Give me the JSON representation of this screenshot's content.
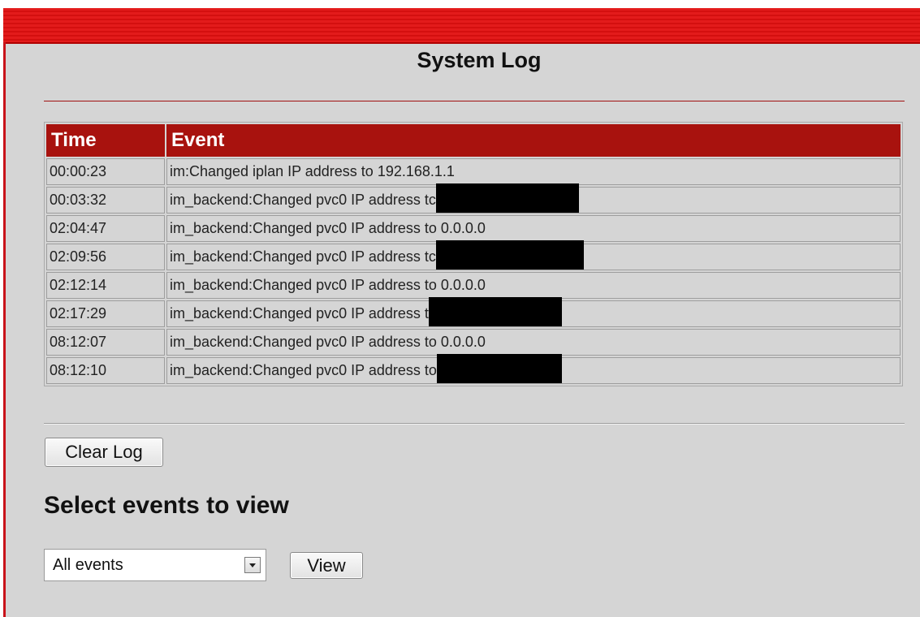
{
  "page": {
    "title": "System Log"
  },
  "log_table": {
    "headers": {
      "time": "Time",
      "event": "Event"
    },
    "rows": [
      {
        "time": "00:00:23",
        "event": "im:Changed iplan IP address to 192.168.1.1",
        "redacted": false
      },
      {
        "time": "00:03:32",
        "event": "im_backend:Changed pvc0 IP address tc",
        "redacted": true
      },
      {
        "time": "02:04:47",
        "event": "im_backend:Changed pvc0 IP address to 0.0.0.0",
        "redacted": false
      },
      {
        "time": "02:09:56",
        "event": "im_backend:Changed pvc0 IP address tc",
        "redacted": true
      },
      {
        "time": "02:12:14",
        "event": "im_backend:Changed pvc0 IP address to 0.0.0.0",
        "redacted": false
      },
      {
        "time": "02:17:29",
        "event": "im_backend:Changed pvc0 IP address t",
        "redacted": true
      },
      {
        "time": "08:12:07",
        "event": "im_backend:Changed pvc0 IP address to 0.0.0.0",
        "redacted": false
      },
      {
        "time": "08:12:10",
        "event": "im_backend:Changed pvc0 IP address to",
        "redacted": true
      }
    ]
  },
  "actions": {
    "clear_log_label": "Clear Log"
  },
  "filter": {
    "heading": "Select events to view",
    "selected": "All events",
    "view_label": "View"
  },
  "colors": {
    "header_red": "#a8120e",
    "top_bar_red": "#e31b1b",
    "page_background": "#d5d5d5"
  }
}
